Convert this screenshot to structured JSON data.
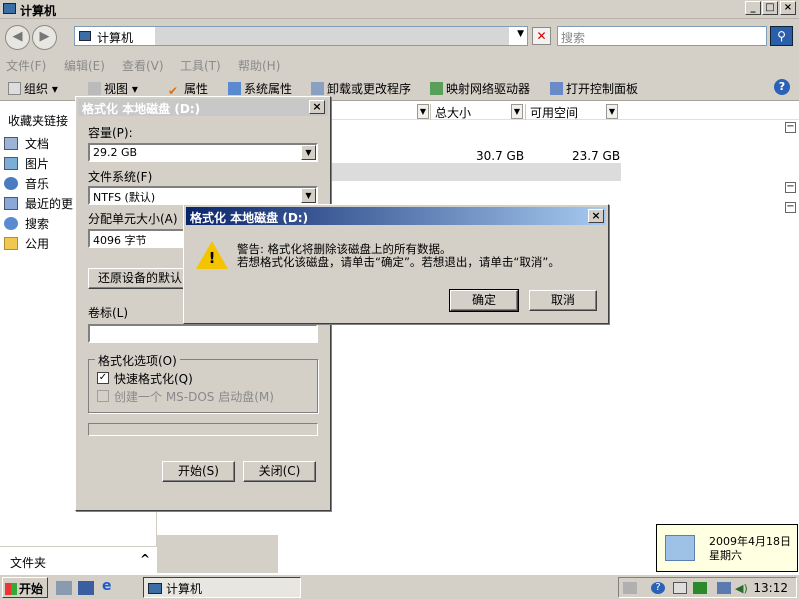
{
  "explorer": {
    "title": "计算机",
    "address_text": "计算机",
    "search_placeholder": "搜索",
    "menu": [
      "文件(F)",
      "编辑(E)",
      "查看(V)",
      "工具(T)",
      "帮助(H)"
    ],
    "toolbar": [
      "组织",
      "视图",
      "属性",
      "系统属性",
      "卸载或更改程序",
      "映射网络驱动器",
      "打开控制面板"
    ],
    "nav_header": "收藏夹链接",
    "nav_items": [
      "文档",
      "图片",
      "音乐",
      "最近的更",
      "搜索",
      "公用"
    ],
    "nav_bottom_label": "文件夹",
    "columns": [
      "总大小",
      "可用空间"
    ],
    "drive_row": {
      "total": "30.7 GB",
      "free": "23.7 GB"
    }
  },
  "format_dialog": {
    "title": "格式化 本地磁盘 (D:)",
    "capacity_label": "容量(P):",
    "capacity_value": "29.2 GB",
    "fs_label": "文件系统(F)",
    "fs_value": "NTFS (默认)",
    "alloc_label": "分配单元大小(A)",
    "alloc_value": "4096 字节",
    "restore_button": "还原设备的默认",
    "volume_label": "卷标(L)",
    "volume_value": "",
    "options_label": "格式化选项(O)",
    "quick_format": "快速格式化(Q)",
    "quick_format_checked": true,
    "msdos": "创建一个 MS-DOS 启动盘(M)",
    "start_button": "开始(S)",
    "close_button": "关闭(C)"
  },
  "warning_dialog": {
    "title": "格式化 本地磁盘 (D:)",
    "line1": "警告: 格式化将删除该磁盘上的所有数据。",
    "line2": "若想格式化该磁盘，请单击“确定”。若想退出，请单击“取消”。",
    "ok": "确定",
    "cancel": "取消"
  },
  "taskbar": {
    "start": "开始",
    "item": "计算机",
    "clock": "13:12"
  },
  "date_popup": {
    "date": "2009年4月18日",
    "weekday": "星期六"
  },
  "icons": {
    "close": "close-icon",
    "minimize": "minimize-icon",
    "maximize": "maximize-icon",
    "help": "help-icon",
    "warning": "warning-icon",
    "search": "search-icon"
  }
}
